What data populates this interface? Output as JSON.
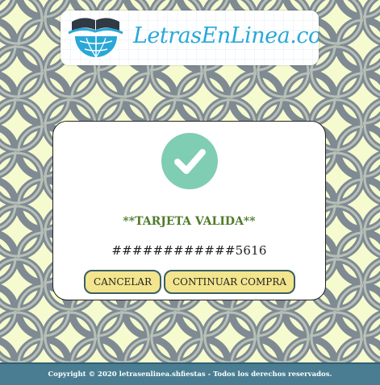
{
  "header": {
    "logo_text": "LetrasEnLinea.com",
    "logo_icon": "book-globe-icon"
  },
  "dialog": {
    "icon": "check-icon",
    "status": "**TARJETA VALIDA**",
    "card_number": "############5616",
    "cancel_label": "CANCELAR",
    "continue_label": "CONTINUAR COMPRA"
  },
  "footer": {
    "copyright": "Copyright © 2020 letrasenlinea.shfiestas - Todos los derechos reservados."
  },
  "colors": {
    "background_pattern": "#7f8a93",
    "pattern_light": "#f6fbcf",
    "accent_green": "#7fcdb2",
    "status_text": "#4f7a2a",
    "button_fill": "#f2e58d",
    "button_border": "#3c5e63",
    "footer_bg": "#4a7d92",
    "logo_blue": "#29a8d8"
  }
}
